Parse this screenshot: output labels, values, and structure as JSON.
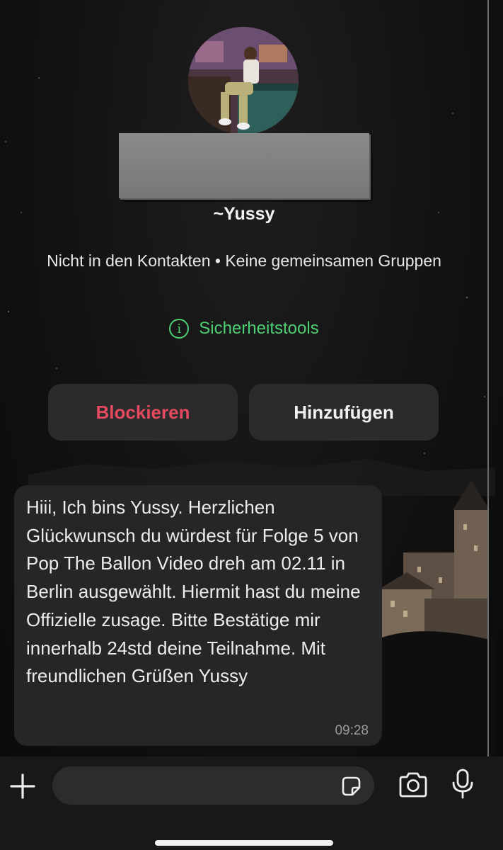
{
  "contact": {
    "name": "~Yussy",
    "info": "Nicht in den Kontakten • Keine gemeinsamen Gruppen",
    "safety_tools": "Sicherheitstools"
  },
  "actions": {
    "block_label": "Blockieren",
    "add_label": "Hinzufügen"
  },
  "message": {
    "text": "Hiii, Ich bins Yussy. Herzlichen Glückwunsch du würdest für Folge 5 von Pop The Ballon Video dreh am 02.11 in Berlin ausgewählt. Hiermit hast du meine Offizielle zusage. Bitte Bestätige mir innerhalb 24std deine Teilnahme. Mit freundlichen Grüßen Yussy",
    "time": "09:28"
  },
  "composer": {
    "placeholder": "",
    "icons": [
      "plus-icon",
      "sticker-icon",
      "camera-icon",
      "microphone-icon"
    ]
  },
  "colors": {
    "danger": "#e4495e",
    "safety": "#4fcf73",
    "bubble": "#262628",
    "button_bg": "#2b2b2d"
  }
}
